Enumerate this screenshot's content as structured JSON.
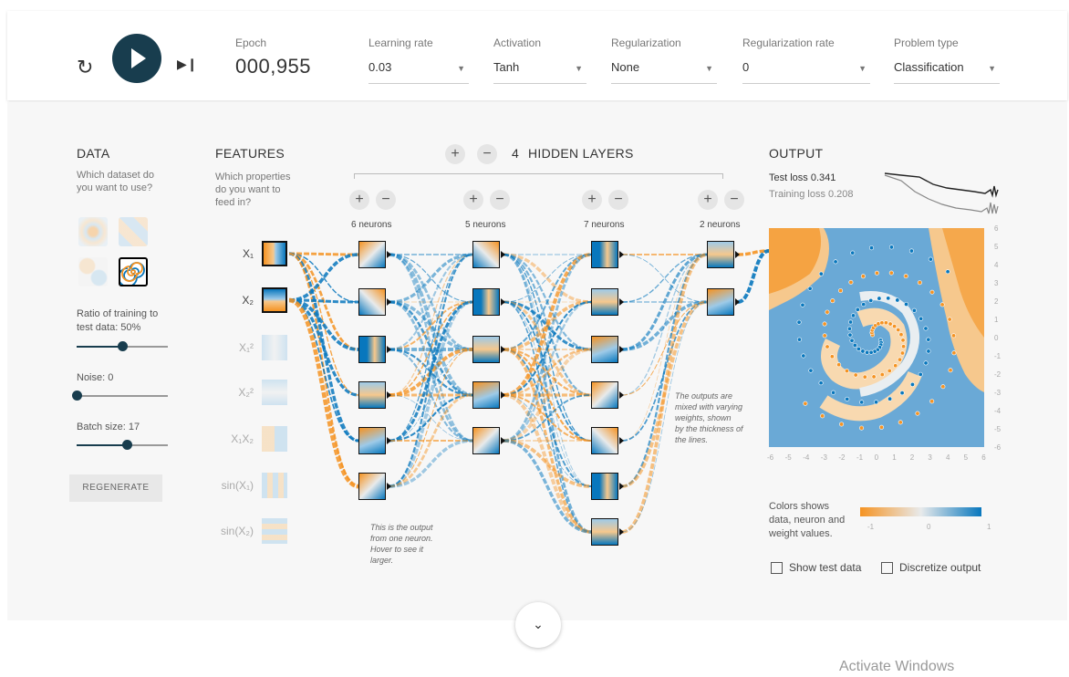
{
  "controls": {
    "epoch_label": "Epoch",
    "epoch_value": "000,955",
    "learning_rate_label": "Learning rate",
    "learning_rate_value": "0.03",
    "activation_label": "Activation",
    "activation_value": "Tanh",
    "regularization_label": "Regularization",
    "regularization_value": "None",
    "regularization_rate_label": "Regularization rate",
    "regularization_rate_value": "0",
    "problem_type_label": "Problem type",
    "problem_type_value": "Classification"
  },
  "data_panel": {
    "title": "DATA",
    "subtitle_1": "Which dataset do",
    "subtitle_2": "you want to use?",
    "ratio_label_1": "Ratio of training to",
    "ratio_label_2": "test data:  50%",
    "ratio_value": 0.5,
    "noise_label": "Noise:  0",
    "noise_value": 0,
    "batch_label": "Batch size:  17",
    "batch_value": 0.55,
    "regenerate_label": "REGENERATE",
    "selected_dataset": "spiral"
  },
  "features_panel": {
    "title": "FEATURES",
    "subtitle_1": "Which properties",
    "subtitle_2": "do you want to",
    "subtitle_3": "feed in?",
    "features": [
      {
        "label": "X₁",
        "active": true
      },
      {
        "label": "X₂",
        "active": true
      },
      {
        "label": "X₁²",
        "active": false
      },
      {
        "label": "X₂²",
        "active": false
      },
      {
        "label": "X₁X₂",
        "active": false
      },
      {
        "label": "sin(X₁)",
        "active": false
      },
      {
        "label": "sin(X₂)",
        "active": false
      }
    ]
  },
  "network": {
    "hidden_layers_count": "4",
    "hidden_layers_label": "HIDDEN LAYERS",
    "layers": [
      {
        "neurons_label": "6 neurons",
        "neurons": 6
      },
      {
        "neurons_label": "5 neurons",
        "neurons": 5
      },
      {
        "neurons_label": "7 neurons",
        "neurons": 7
      },
      {
        "neurons_label": "2 neurons",
        "neurons": 2
      }
    ],
    "note_neuron": [
      "This is the output",
      "from one neuron.",
      "Hover to see it",
      "larger."
    ],
    "note_weights": [
      "The outputs are",
      "mixed with varying",
      "weights, shown",
      "by the thickness of",
      "the lines."
    ]
  },
  "output_panel": {
    "title": "OUTPUT",
    "test_loss": "Test loss 0.341",
    "training_loss": "Training loss 0.208",
    "y_ticks": [
      "6",
      "5",
      "4",
      "3",
      "2",
      "1",
      "0",
      "-1",
      "-2",
      "-3",
      "-4",
      "-5",
      "-6"
    ],
    "x_ticks": [
      "-6",
      "-5",
      "-4",
      "-3",
      "-2",
      "-1",
      "0",
      "1",
      "2",
      "3",
      "4",
      "5",
      "6"
    ],
    "legend_1": "Colors shows",
    "legend_2": "data, neuron and",
    "legend_3": "weight values.",
    "legend_min": "-1",
    "legend_mid": "0",
    "legend_max": "1",
    "show_test_label": "Show test data",
    "discretize_label": "Discretize output"
  },
  "colors": {
    "orange": "#f59322",
    "blue": "#0877bd",
    "play": "#183d4e"
  },
  "watermark": "Activate Windows"
}
